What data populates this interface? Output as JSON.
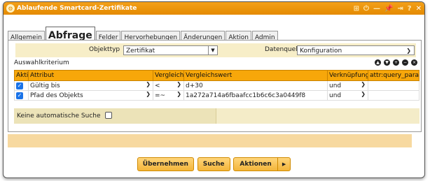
{
  "window": {
    "title": "Ablaufende Smartcard-Zertifikate",
    "controls": [
      "⊞",
      "⏻",
      "—",
      "📌",
      "⇥",
      "?",
      "✕"
    ]
  },
  "tabs": [
    "Allgemein",
    "Abfrage",
    "Felder",
    "Hervorhebungen",
    "Änderungen",
    "Aktion",
    "Admin"
  ],
  "active_tab": "Abfrage",
  "objekttyp": {
    "label": "Objekttyp",
    "value": "Zertifikat"
  },
  "datenquelle": {
    "label": "Datenquelle",
    "value": "Konfiguration"
  },
  "criteria": {
    "title": "Auswahlkriterium",
    "icons": [
      "up-icon",
      "down-icon",
      "add-icon",
      "remove-icon",
      "delete-icon"
    ],
    "columns": [
      "Aktiv",
      "Attribut",
      "Vergleich",
      "Vergleichswert",
      "Verknüpfung",
      "attr:query_param"
    ],
    "rows": [
      {
        "active": true,
        "attribut": "Gültig bis",
        "vergleich": "<",
        "wert": "d+30",
        "verknuepfung": "und",
        "param": ""
      },
      {
        "active": true,
        "attribut": "Pfad des Objekts",
        "vergleich": "=~",
        "wert": "1a272a714a6fbaafcc1b6c6c3a0449f8",
        "verknuepfung": "und",
        "param": ""
      }
    ],
    "no_auto_search": "Keine automatische Suche"
  },
  "buttons": {
    "uebernehmen": "Übernehmen",
    "suche": "Suche",
    "aktionen": "Aktionen"
  },
  "colors": {
    "title_bar": "#e48a00",
    "table_header": "#f7a70a",
    "button": "#f3b53a"
  }
}
